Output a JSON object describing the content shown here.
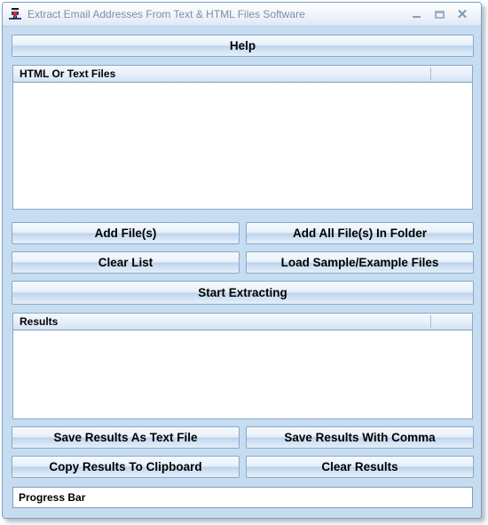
{
  "window": {
    "title": "Extract Email Addresses From Text & HTML Files Software",
    "icon": "app-icon",
    "controls": {
      "minimize": "minimize-icon",
      "maximize": "maximize-icon",
      "close": "close-icon"
    }
  },
  "colors": {
    "window_background": "#c6dcf1",
    "button_border": "#8aa9c8",
    "title_text": "#7b8fa6",
    "panel_background": "#ffffff"
  },
  "toolbar": {
    "help_label": "Help"
  },
  "files_list": {
    "column_header": "HTML Or Text Files",
    "rows": []
  },
  "file_buttons": {
    "add_files": "Add File(s)",
    "add_all_files_in_folder": "Add All File(s) In Folder",
    "clear_list": "Clear List",
    "load_sample_example_files": "Load Sample/Example Files"
  },
  "action": {
    "start_extracting": "Start Extracting"
  },
  "results_list": {
    "column_header": "Results",
    "rows": []
  },
  "result_buttons": {
    "save_results_as_text_file": "Save Results As Text File",
    "save_results_with_comma": "Save Results With Comma",
    "copy_results_to_clipboard": "Copy Results To Clipboard",
    "clear_results": "Clear Results"
  },
  "status": {
    "progress_label": "Progress Bar"
  }
}
